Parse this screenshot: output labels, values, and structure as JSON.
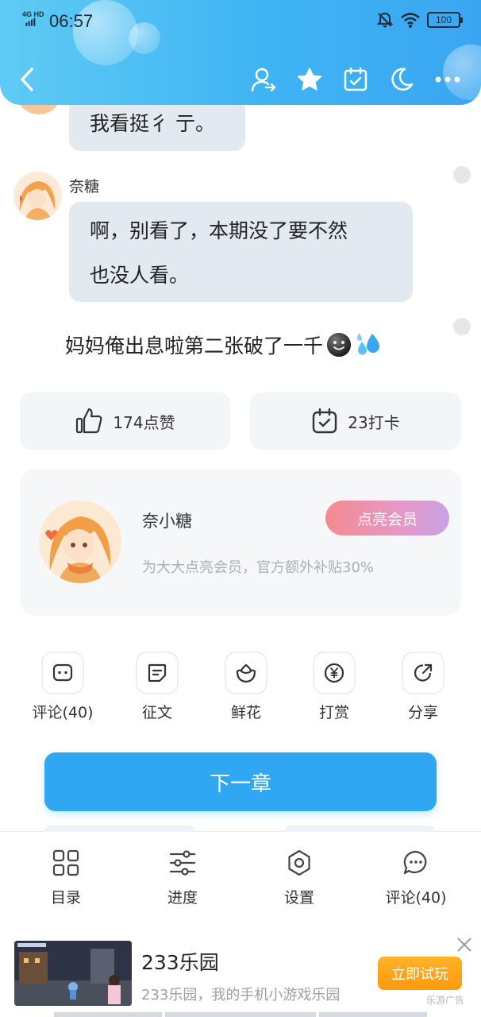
{
  "status_bar": {
    "network": "4G HD",
    "time": "06:57",
    "battery": "100"
  },
  "toolbar": {
    "icons": [
      "back-icon",
      "author-switch-icon",
      "star-icon",
      "calendar-check-icon",
      "moon-icon",
      "more-icon"
    ]
  },
  "messages": [
    {
      "sender": "",
      "text_lines": [
        "我看挺彳 亍。"
      ]
    },
    {
      "sender": "奈糖",
      "text_lines": [
        "啊，别看了，本期没了要不然",
        "也没人看。"
      ]
    }
  ],
  "body_text": "妈妈俺出息啦第二张破了一千",
  "body_emojis": [
    "smiley-face-icon",
    "sweat-droplets-icon"
  ],
  "stats": {
    "like_label": "174点赞",
    "checkin_label": "23打卡"
  },
  "author_card": {
    "name": "奈小糖",
    "vip_button": "点亮会员",
    "subtitle": "为大大点亮会员，官方额外补贴30%"
  },
  "tools": [
    {
      "label": "评论(40)",
      "icon": "comment-icon"
    },
    {
      "label": "征文",
      "icon": "essay-icon"
    },
    {
      "label": "鲜花",
      "icon": "flower-icon"
    },
    {
      "label": "打赏",
      "icon": "yuan-coin-icon"
    },
    {
      "label": "分享",
      "icon": "share-icon"
    }
  ],
  "next_chapter": "下一章",
  "bottom_nav": [
    {
      "label": "目录",
      "icon": "grid-icon"
    },
    {
      "label": "进度",
      "icon": "sliders-icon"
    },
    {
      "label": "设置",
      "icon": "gear-icon"
    },
    {
      "label": "评论(40)",
      "icon": "comment-bubble-icon"
    }
  ],
  "ad": {
    "title": "233乐园",
    "subtitle": "233乐园，我的手机小游戏乐园",
    "cta": "立即试玩",
    "tag": "乐游广告"
  },
  "colors": {
    "header_start": "#5fcbf5",
    "header_end": "#3aa6f2",
    "primary_button": "#2fa7f3",
    "bubble_bg": "#e3e9f1",
    "cta_orange": "#ff9a0c"
  }
}
